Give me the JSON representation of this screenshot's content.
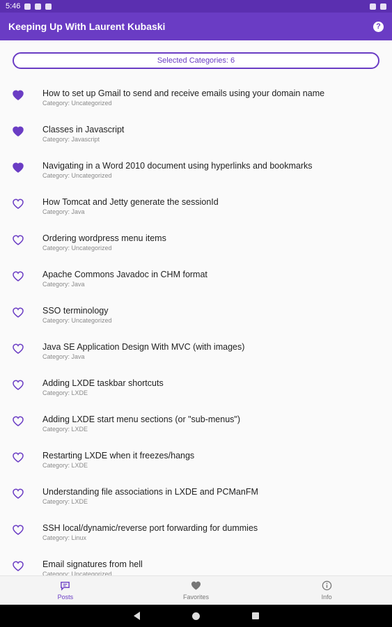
{
  "status_bar": {
    "time": "5:46"
  },
  "app_bar": {
    "title": "Keeping Up With Laurent Kubaski",
    "help_icon": "help-circle-icon"
  },
  "filter": {
    "label": "Selected Categories: 6"
  },
  "posts": [
    {
      "title": "How to set up Gmail to send and receive emails using your domain name",
      "category": "Category: Uncategorized",
      "favorite": true
    },
    {
      "title": "Classes in Javascript",
      "category": "Category: Javascript",
      "favorite": true
    },
    {
      "title": "Navigating in a Word 2010 document using hyperlinks and bookmarks",
      "category": "Category: Uncategorized",
      "favorite": true
    },
    {
      "title": "How Tomcat and Jetty generate the sessionId",
      "category": "Category: Java",
      "favorite": false
    },
    {
      "title": "Ordering wordpress menu items",
      "category": "Category: Uncategorized",
      "favorite": false
    },
    {
      "title": "Apache Commons Javadoc in CHM format",
      "category": "Category: Java",
      "favorite": false
    },
    {
      "title": "SSO terminology",
      "category": "Category: Uncategorized",
      "favorite": false
    },
    {
      "title": "Java SE Application Design With MVC (with images)",
      "category": "Category: Java",
      "favorite": false
    },
    {
      "title": "Adding LXDE taskbar shortcuts",
      "category": "Category: LXDE",
      "favorite": false
    },
    {
      "title": "Adding LXDE start menu sections (or \"sub-menus\")",
      "category": "Category: LXDE",
      "favorite": false
    },
    {
      "title": "Restarting LXDE when it freezes/hangs",
      "category": "Category: LXDE",
      "favorite": false
    },
    {
      "title": "Understanding file associations in LXDE and PCManFM",
      "category": "Category: LXDE",
      "favorite": false
    },
    {
      "title": "SSH local/dynamic/reverse port forwarding for dummies",
      "category": "Category: Linux",
      "favorite": false
    },
    {
      "title": "Email signatures from hell",
      "category": "Category: Uncategorized",
      "favorite": false
    }
  ],
  "bottom_nav": [
    {
      "label": "Posts",
      "icon": "chat-bubble-icon",
      "active": true
    },
    {
      "label": "Favorites",
      "icon": "heart-icon",
      "active": false
    },
    {
      "label": "Info",
      "icon": "info-icon",
      "active": false
    }
  ],
  "colors": {
    "accent": "#6a3cc4",
    "status_bar": "#5b2fb0",
    "favorite": "#6a3cc4"
  }
}
